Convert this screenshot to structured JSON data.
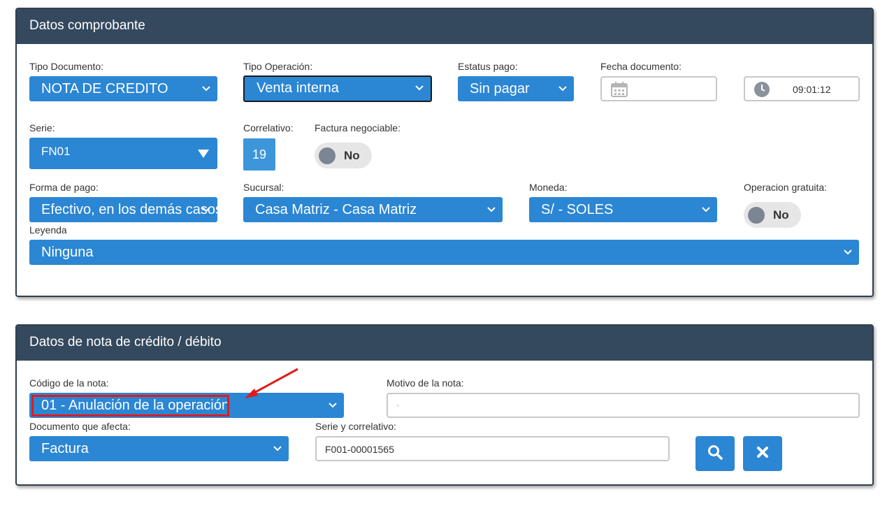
{
  "panel1": {
    "title": "Datos comprobante",
    "tipo_documento": {
      "label": "Tipo Documento:",
      "value": "NOTA DE CREDITO"
    },
    "tipo_operacion": {
      "label": "Tipo Operación:",
      "value": "Venta interna"
    },
    "estatus_pago": {
      "label": "Estatus pago:",
      "value": "Sin pagar"
    },
    "fecha_documento": {
      "label": "Fecha documento:",
      "value": ""
    },
    "hora": {
      "value": "09:01:12"
    },
    "serie": {
      "label": "Serie:",
      "value": "FN01"
    },
    "correlativo": {
      "label": "Correlativo:",
      "value": "19"
    },
    "factura_negociable": {
      "label": "Factura negociable:",
      "value": "No"
    },
    "forma_pago": {
      "label": "Forma de pago:",
      "value": "Efectivo, en los demás casos"
    },
    "sucursal": {
      "label": "Sucursal:",
      "value": "Casa Matriz - Casa Matriz"
    },
    "moneda": {
      "label": "Moneda:",
      "value": "S/ - SOLES"
    },
    "operacion_gratuita": {
      "label": "Operacion gratuita:",
      "value": "No"
    },
    "leyenda": {
      "label": "Leyenda",
      "value": "Ninguna"
    }
  },
  "panel2": {
    "title": "Datos de nota de crédito / débito",
    "codigo_nota": {
      "label": "Código de la nota:",
      "value": "01 - Anulación de la operación"
    },
    "motivo_nota": {
      "label": "Motivo de la nota:",
      "value": "-"
    },
    "documento_afecta": {
      "label": "Documento que afecta:",
      "value": "Factura"
    },
    "serie_correlativo": {
      "label": "Serie y correlativo:",
      "value": "F001-00001565"
    }
  },
  "colors": {
    "header_bg": "#34495e",
    "select_bg": "#2b86d4",
    "highlight": "#e01b1b"
  },
  "icons": {
    "chevron": "chevron-down-icon",
    "calendar": "calendar-icon",
    "clock": "clock-icon",
    "search": "search-icon",
    "close": "close-icon",
    "arrow": "red-arrow-annotation"
  }
}
